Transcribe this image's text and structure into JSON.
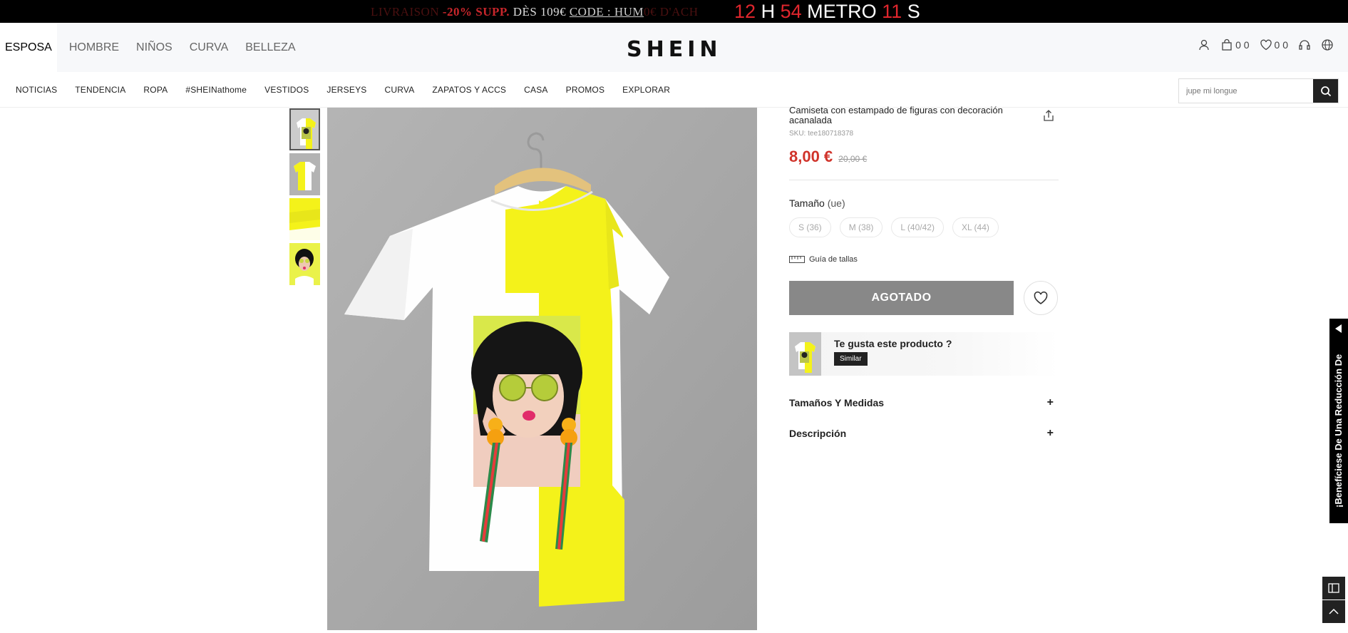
{
  "promo": {
    "faded_left": "LIVRAISON ",
    "discount": "-20% SUPP.",
    "condition": " DÈS 109€ ",
    "code": "CODE : HUM",
    "faded_right": "0€ D'ACH"
  },
  "countdown": {
    "hours": "12",
    "hours_unit": "H",
    "minutes": "54",
    "minutes_unit": "METRO",
    "seconds": "11",
    "seconds_unit": "S"
  },
  "header": {
    "categories": [
      "ESPOSA",
      "HOMBRE",
      "NIÑOS",
      "CURVA",
      "BELLEZA"
    ],
    "logo": "SHEIN",
    "cart_count": "0 0",
    "wishlist_count": "0 0"
  },
  "nav": {
    "items": [
      "NOTICIAS",
      "TENDENCIA",
      "ROPA",
      "#SHEINathome",
      "VESTIDOS",
      "JERSEYS",
      "CURVA",
      "ZAPATOS Y ACCS",
      "CASA",
      "PROMOS",
      "EXPLORAR"
    ],
    "search_placeholder": "jupe mi longue"
  },
  "product": {
    "title": "Camiseta con estampado de figuras con decoración acanalada",
    "sku": "SKU: tee180718378",
    "price": "8,00 €",
    "original_price": "20,00 €",
    "size_label": "Tamaño",
    "size_unit": "(ue)",
    "sizes": [
      "S (36)",
      "M (38)",
      "L (40/42)",
      "XL (44)"
    ],
    "size_guide": "Guía de tallas",
    "soldout_label": "AGOTADO",
    "similar_question": "Te gusta este producto ?",
    "similar_button": "Similar",
    "accordion": [
      "Tamaños Y Medidas",
      "Descripción"
    ]
  },
  "side_tab": {
    "label": "¡Benefíciese De Una Reducción De"
  },
  "colors": {
    "price_red": "#d0332a",
    "countdown_red": "#e0262d",
    "shirt_yellow": "#f4f21a"
  }
}
